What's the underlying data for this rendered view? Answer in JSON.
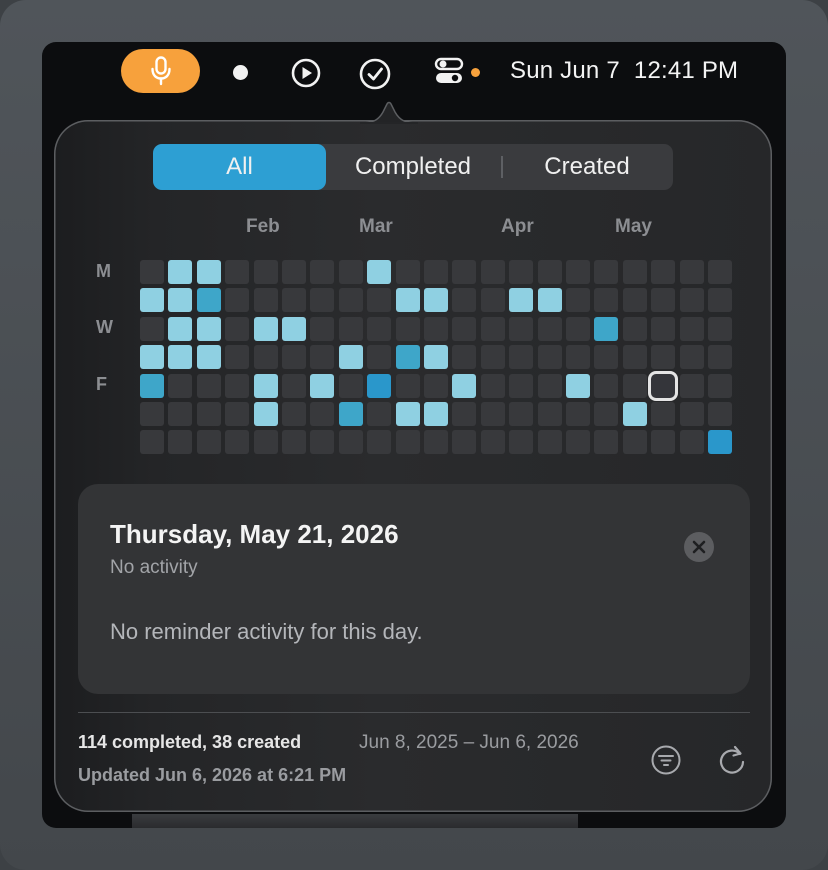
{
  "menubar": {
    "mic_icon": "microphone-icon",
    "status_dot_icon": "circle-icon",
    "play_icon": "play-circle-icon",
    "reminders_icon": "checkmark-circle-icon",
    "control_center_icon": "toggles-icon",
    "date": "Sun Jun 7",
    "time": "12:41 PM",
    "accent": "#f7a13c"
  },
  "segments": [
    {
      "label": "All",
      "selected": true
    },
    {
      "label": "Completed",
      "selected": false
    },
    {
      "label": "Created",
      "selected": false
    }
  ],
  "calendar": {
    "months": [
      "Feb",
      "Mar",
      "Apr",
      "May"
    ],
    "weekday_labels": [
      "M",
      "W",
      "F"
    ],
    "colors": {
      "empty": "#38393c",
      "level1": "#8fd0e2",
      "level2": "#3ea6c9",
      "level3": "#2a97cb"
    },
    "levels": [
      [
        0,
        1,
        1,
        0,
        0,
        0,
        0,
        0,
        1,
        0,
        0,
        0,
        0,
        0,
        0,
        0,
        0,
        0,
        0,
        0,
        0
      ],
      [
        1,
        1,
        2,
        0,
        0,
        0,
        0,
        0,
        0,
        1,
        1,
        0,
        0,
        1,
        1,
        0,
        0,
        0,
        0,
        0,
        0
      ],
      [
        0,
        1,
        1,
        0,
        1,
        1,
        0,
        0,
        0,
        0,
        0,
        0,
        0,
        0,
        0,
        0,
        2,
        0,
        0,
        0,
        0
      ],
      [
        1,
        1,
        1,
        0,
        0,
        0,
        0,
        1,
        0,
        2,
        1,
        0,
        0,
        0,
        0,
        0,
        0,
        0,
        0,
        0,
        0
      ],
      [
        2,
        0,
        0,
        0,
        1,
        0,
        1,
        0,
        3,
        0,
        0,
        1,
        0,
        0,
        0,
        1,
        0,
        0,
        0,
        0,
        0
      ],
      [
        0,
        0,
        0,
        0,
        1,
        0,
        0,
        2,
        0,
        1,
        1,
        0,
        0,
        0,
        0,
        0,
        0,
        1,
        0,
        0,
        0
      ],
      [
        0,
        0,
        0,
        0,
        0,
        0,
        0,
        0,
        0,
        0,
        0,
        0,
        0,
        0,
        0,
        0,
        0,
        0,
        0,
        0,
        3
      ]
    ],
    "selected_cell": {
      "row": 4,
      "col": 18
    }
  },
  "detail": {
    "title": "Thursday, May 21, 2026",
    "subtitle": "No activity",
    "message": "No reminder activity for this day.",
    "close_icon": "close-icon"
  },
  "footer": {
    "stats": "114 completed, 38 created",
    "range": "Jun 8, 2025 – Jun 6, 2026",
    "updated": "Updated Jun 6, 2026 at 6:21 PM",
    "filter_icon": "filter-icon",
    "refresh_icon": "refresh-icon"
  }
}
